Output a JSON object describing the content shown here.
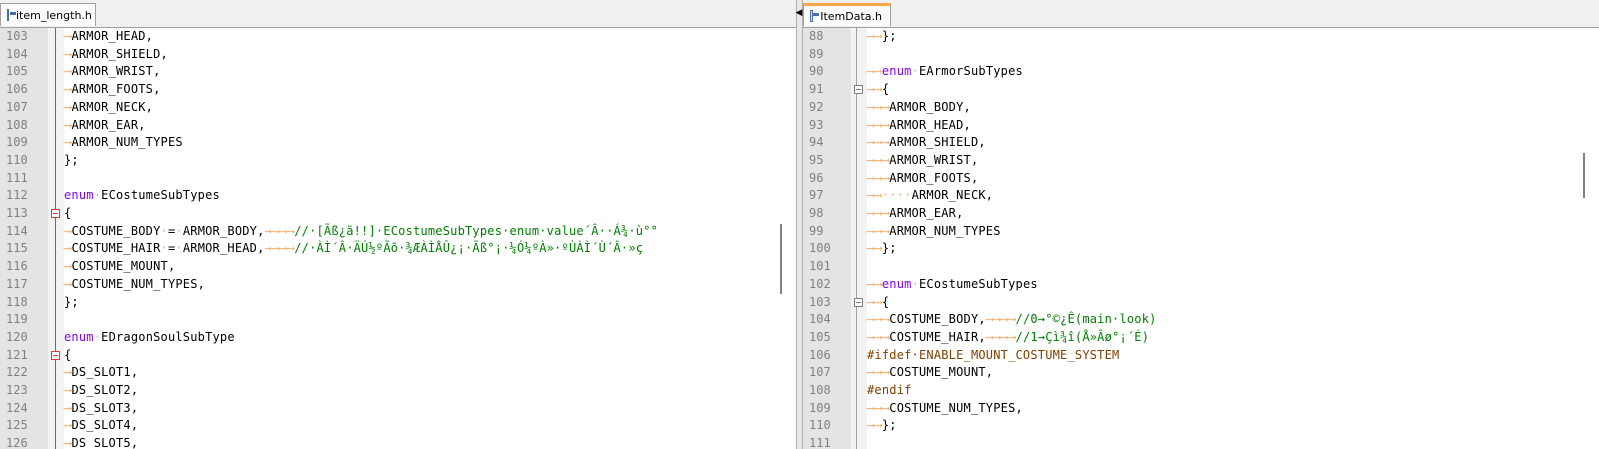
{
  "left": {
    "tab": "item_length.h",
    "lines": [
      {
        "n": "103",
        "fold": false,
        "segs": [
          [
            "ws",
            "⟶"
          ],
          [
            "t",
            "ARMOR_HEAD,"
          ]
        ]
      },
      {
        "n": "104",
        "fold": false,
        "segs": [
          [
            "ws",
            "⟶"
          ],
          [
            "t",
            "ARMOR_SHIELD,"
          ]
        ]
      },
      {
        "n": "105",
        "fold": false,
        "segs": [
          [
            "ws",
            "⟶"
          ],
          [
            "t",
            "ARMOR_WRIST,"
          ]
        ]
      },
      {
        "n": "106",
        "fold": false,
        "segs": [
          [
            "ws",
            "⟶"
          ],
          [
            "t",
            "ARMOR_FOOTS,"
          ]
        ]
      },
      {
        "n": "107",
        "fold": false,
        "segs": [
          [
            "ws",
            "⟶"
          ],
          [
            "t",
            "ARMOR_NECK,"
          ]
        ]
      },
      {
        "n": "108",
        "fold": false,
        "segs": [
          [
            "ws",
            "⟶"
          ],
          [
            "t",
            "ARMOR_EAR,"
          ]
        ]
      },
      {
        "n": "109",
        "fold": false,
        "segs": [
          [
            "ws",
            "⟶"
          ],
          [
            "t",
            "ARMOR_NUM_TYPES"
          ]
        ]
      },
      {
        "n": "110",
        "fold": false,
        "segs": [
          [
            "t",
            "};"
          ]
        ]
      },
      {
        "n": "111",
        "fold": false,
        "segs": []
      },
      {
        "n": "112",
        "fold": false,
        "segs": [
          [
            "kw",
            "enum"
          ],
          [
            "ws",
            "·"
          ],
          [
            "t",
            "ECostumeSubTypes"
          ]
        ]
      },
      {
        "n": "113",
        "fold": true,
        "segs": [
          [
            "t",
            "{"
          ]
        ]
      },
      {
        "n": "114",
        "fold": false,
        "segs": [
          [
            "ws",
            "⟶"
          ],
          [
            "t",
            "COSTUME_BODY"
          ],
          [
            "ws",
            "·"
          ],
          [
            "t",
            "="
          ],
          [
            "ws",
            "·"
          ],
          [
            "t",
            "ARMOR_BODY,"
          ],
          [
            "ws",
            "→⟶⟶⟶"
          ],
          [
            "cm",
            "//·[Ãß¿ä!!]·ECostumeSubTypes·enum·value´Â··Á¾·ù°°"
          ]
        ]
      },
      {
        "n": "115",
        "fold": false,
        "segs": [
          [
            "ws",
            "⟶"
          ],
          [
            "t",
            "COSTUME_HAIR"
          ],
          [
            "ws",
            "·"
          ],
          [
            "t",
            "="
          ],
          [
            "ws",
            "·"
          ],
          [
            "t",
            "ARMOR_HEAD,"
          ],
          [
            "ws",
            "→⟶⟶⟶"
          ],
          [
            "cm",
            "//·ÀÌ´Â·ÄÚ½ºÃõ·¾ÆÀÌÅÛ¿¡·Ãß°¡·¼Ó¼ºÀ»·ºÙÀÌ´Ù´Â·»ç"
          ]
        ]
      },
      {
        "n": "116",
        "fold": false,
        "segs": [
          [
            "ws",
            "⟶"
          ],
          [
            "t",
            "COSTUME_MOUNT,"
          ]
        ]
      },
      {
        "n": "117",
        "fold": false,
        "segs": [
          [
            "ws",
            "⟶"
          ],
          [
            "t",
            "COSTUME_NUM_TYPES,"
          ]
        ]
      },
      {
        "n": "118",
        "fold": false,
        "segs": [
          [
            "t",
            "};"
          ]
        ]
      },
      {
        "n": "119",
        "fold": false,
        "segs": []
      },
      {
        "n": "120",
        "fold": false,
        "segs": [
          [
            "kw",
            "enum"
          ],
          [
            "ws",
            "·"
          ],
          [
            "t",
            "EDragonSoulSubType"
          ]
        ]
      },
      {
        "n": "121",
        "fold": true,
        "segs": [
          [
            "t",
            "{"
          ]
        ]
      },
      {
        "n": "122",
        "fold": false,
        "segs": [
          [
            "ws",
            "⟶"
          ],
          [
            "t",
            "DS_SLOT1,"
          ]
        ]
      },
      {
        "n": "123",
        "fold": false,
        "segs": [
          [
            "ws",
            "⟶"
          ],
          [
            "t",
            "DS_SLOT2,"
          ]
        ]
      },
      {
        "n": "124",
        "fold": false,
        "segs": [
          [
            "ws",
            "⟶"
          ],
          [
            "t",
            "DS_SLOT3,"
          ]
        ]
      },
      {
        "n": "125",
        "fold": false,
        "segs": [
          [
            "ws",
            "⟶"
          ],
          [
            "t",
            "DS_SLOT4,"
          ]
        ]
      },
      {
        "n": "126",
        "fold": false,
        "segs": [
          [
            "ws",
            "⟶"
          ],
          [
            "t",
            "DS_SLOT5,"
          ]
        ]
      }
    ]
  },
  "right": {
    "tab": "ItemData.h",
    "lines": [
      {
        "n": "88",
        "fold": false,
        "segs": [
          [
            "ws",
            "⟶⟶"
          ],
          [
            "t",
            "};"
          ]
        ]
      },
      {
        "n": "89",
        "fold": false,
        "segs": []
      },
      {
        "n": "90",
        "fold": false,
        "segs": [
          [
            "ws",
            "⟶⟶"
          ],
          [
            "kw",
            "enum"
          ],
          [
            "ws",
            "·"
          ],
          [
            "t",
            "EArmorSubTypes"
          ]
        ]
      },
      {
        "n": "91",
        "fold": true,
        "segs": [
          [
            "ws",
            "⟶⟶"
          ],
          [
            "t",
            "{"
          ]
        ]
      },
      {
        "n": "92",
        "fold": false,
        "segs": [
          [
            "ws",
            "⟶⟶⟶"
          ],
          [
            "t",
            "ARMOR_BODY,"
          ]
        ]
      },
      {
        "n": "93",
        "fold": false,
        "segs": [
          [
            "ws",
            "⟶⟶⟶"
          ],
          [
            "t",
            "ARMOR_HEAD,"
          ]
        ]
      },
      {
        "n": "94",
        "fold": false,
        "segs": [
          [
            "ws",
            "⟶⟶⟶"
          ],
          [
            "t",
            "ARMOR_SHIELD,"
          ]
        ]
      },
      {
        "n": "95",
        "fold": false,
        "segs": [
          [
            "ws",
            "⟶⟶⟶"
          ],
          [
            "t",
            "ARMOR_WRIST,"
          ]
        ]
      },
      {
        "n": "96",
        "fold": false,
        "segs": [
          [
            "ws",
            "⟶⟶⟶"
          ],
          [
            "t",
            "ARMOR_FOOTS,"
          ]
        ]
      },
      {
        "n": "97",
        "fold": false,
        "segs": [
          [
            "ws",
            "⟶⟶····"
          ],
          [
            "t",
            "ARMOR_NECK,"
          ]
        ]
      },
      {
        "n": "98",
        "fold": false,
        "segs": [
          [
            "ws",
            "⟶⟶⟶"
          ],
          [
            "t",
            "ARMOR_EAR,"
          ]
        ]
      },
      {
        "n": "99",
        "fold": false,
        "segs": [
          [
            "ws",
            "⟶⟶⟶"
          ],
          [
            "t",
            "ARMOR_NUM_TYPES"
          ]
        ]
      },
      {
        "n": "100",
        "fold": false,
        "segs": [
          [
            "ws",
            "⟶⟶"
          ],
          [
            "t",
            "};"
          ]
        ]
      },
      {
        "n": "101",
        "fold": false,
        "segs": []
      },
      {
        "n": "102",
        "fold": false,
        "segs": [
          [
            "ws",
            "⟶⟶"
          ],
          [
            "kw",
            "enum"
          ],
          [
            "ws",
            "·"
          ],
          [
            "t",
            "ECostumeSubTypes"
          ]
        ]
      },
      {
        "n": "103",
        "fold": true,
        "segs": [
          [
            "ws",
            "⟶⟶"
          ],
          [
            "t",
            "{"
          ]
        ]
      },
      {
        "n": "104",
        "fold": false,
        "segs": [
          [
            "ws",
            "⟶⟶⟶"
          ],
          [
            "t",
            "COSTUME_BODY,"
          ],
          [
            "ws",
            "⟶⟶⟶⟶"
          ],
          [
            "cm",
            "//0→°©¿Ê(main·look)"
          ]
        ]
      },
      {
        "n": "105",
        "fold": false,
        "segs": [
          [
            "ws",
            "⟶⟶⟶"
          ],
          [
            "t",
            "COSTUME_HAIR,"
          ],
          [
            "ws",
            "⟶⟶⟶⟶"
          ],
          [
            "cm",
            "//1→Çì¾î(Å»Âø°¡´É)"
          ]
        ]
      },
      {
        "n": "106",
        "fold": false,
        "segs": [
          [
            "pp",
            "#ifdef·ENABLE_MOUNT_COSTUME_SYSTEM"
          ]
        ]
      },
      {
        "n": "107",
        "fold": false,
        "segs": [
          [
            "ws",
            "⟶⟶⟶"
          ],
          [
            "t",
            "COSTUME_MOUNT,"
          ]
        ]
      },
      {
        "n": "108",
        "fold": false,
        "segs": [
          [
            "pp",
            "#endif"
          ]
        ]
      },
      {
        "n": "109",
        "fold": false,
        "segs": [
          [
            "ws",
            "⟶⟶⟶"
          ],
          [
            "t",
            "COSTUME_NUM_TYPES,"
          ]
        ]
      },
      {
        "n": "110",
        "fold": false,
        "segs": [
          [
            "ws",
            "⟶⟶"
          ],
          [
            "t",
            "};"
          ]
        ]
      },
      {
        "n": "111",
        "fold": false,
        "segs": []
      }
    ]
  }
}
